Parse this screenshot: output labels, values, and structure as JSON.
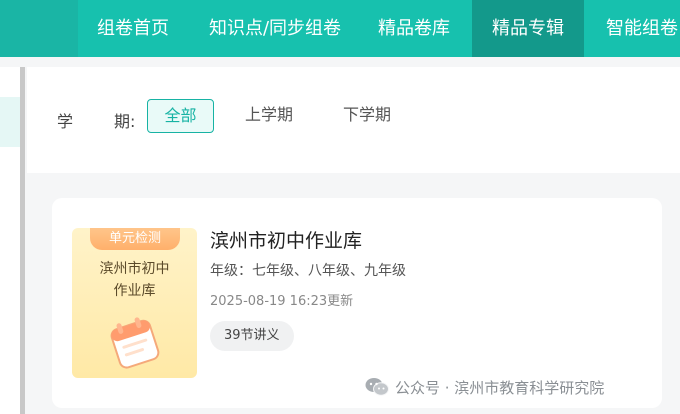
{
  "nav": {
    "items": [
      {
        "label": "组卷首页",
        "active": false
      },
      {
        "label": "知识点/同步组卷",
        "active": false
      },
      {
        "label": "精品卷库",
        "active": false
      },
      {
        "label": "精品专辑",
        "active": true
      },
      {
        "label": "智能组卷",
        "active": false
      }
    ]
  },
  "filter": {
    "label_part1": "学",
    "label_part2": "期:",
    "options": [
      {
        "label": "全部",
        "selected": true
      },
      {
        "label": "上学期",
        "selected": false
      },
      {
        "label": "下学期",
        "selected": false
      }
    ]
  },
  "card": {
    "cover": {
      "badge": "单元检测",
      "title_line1": "滨州市初中",
      "title_line2": "作业库",
      "icon": "calendar-icon"
    },
    "title": "滨州市初中作业库",
    "grade": "年级：七年级、八年级、九年级",
    "updated": "2025-08-19 16:23更新",
    "tag": "39节讲义"
  },
  "watermark": {
    "icon": "wechat-icon",
    "text": "公众号 · 滨州市教育科学研究院"
  },
  "colors": {
    "nav_bg": "#17c1ae",
    "nav_active": "#13998b",
    "accent": "#17b3a4"
  }
}
